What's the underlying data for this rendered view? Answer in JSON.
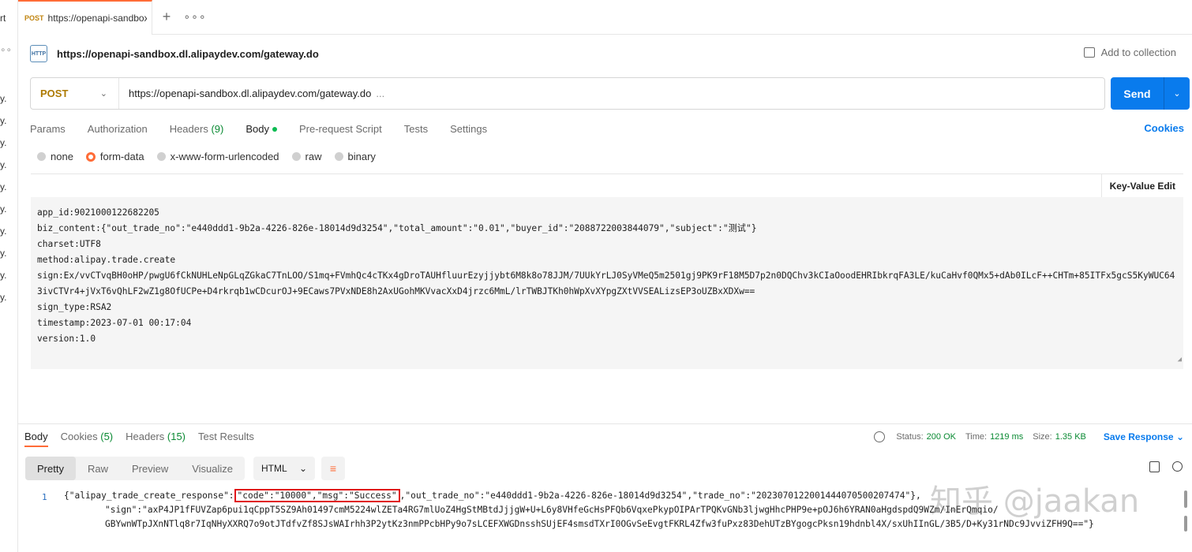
{
  "left_strip": {
    "fragments": [
      "rt",
      "∘∘",
      "y.",
      "y.",
      "y.",
      "y.",
      "y.",
      "y.",
      "y.",
      "y.",
      "y."
    ]
  },
  "tab": {
    "method": "POST",
    "url": "https://openapi-sandbox.dl.alipaydev.com/gateway.do"
  },
  "request": {
    "title": "https://openapi-sandbox.dl.alipaydev.com/gateway.do",
    "add_to_collection": "Add to collection",
    "method": "POST",
    "url": "https://openapi-sandbox.dl.alipaydev.com/gateway.do",
    "url_more": "...",
    "send": "Send"
  },
  "request_tabs": {
    "params": "Params",
    "authorization": "Authorization",
    "headers": "Headers",
    "headers_count": "(9)",
    "body": "Body",
    "pre_request": "Pre-request Script",
    "tests": "Tests",
    "settings": "Settings",
    "cookies": "Cookies"
  },
  "body_types": {
    "none": "none",
    "form_data": "form-data",
    "urlencoded": "x-www-form-urlencoded",
    "raw": "raw",
    "binary": "binary",
    "selected": "form-data"
  },
  "key_value_edit": "Key-Value Edit",
  "body_lines": [
    "app_id:9021000122682205",
    "biz_content:{\"out_trade_no\":\"e440ddd1-9b2a-4226-826e-18014d9d3254\",\"total_amount\":\"0.01\",\"buyer_id\":\"2088722003844079\",\"subject\":\"测试\"}",
    "charset:UTF8",
    "method:alipay.trade.create",
    "sign:Ex/vvCTvqBH0oHP/pwgU6fCkNUHLeNpGLqZGkaC7TnLOO/S1mq+FVmhQc4cTKx4gDroTAUHfluurEzyjjybt6M8k8o78JJM/7UUkYrLJ0SyVMeQ5m2501gj9PK9rF18M5D7p2n0DQChv3kCIaOoodEHRIbkrqFA3LE/kuCaHvf0QMx5+dAb0ILcF++CHTm+85ITFx5gcS5KyWUC643ivCTVr4+jVxT6vQhLF2wZ1g8OfUCPe+D4rkrqb1wCDcurOJ+9ECaws7PVxNDE8h2AxUGohMKVvacXxD4jrzc6MmL/lrTWBJTKh0hWpXvXYpgZXtVVSEALizsEP3oUZBxXDXw==",
    "sign_type:RSA2",
    "timestamp:2023-07-01 00:17:04",
    "version:1.0"
  ],
  "response": {
    "tabs": {
      "body": "Body",
      "cookies": "Cookies",
      "cookies_count": "(5)",
      "headers": "Headers",
      "headers_count": "(15)",
      "test_results": "Test Results"
    },
    "status_label": "Status:",
    "status": "200 OK",
    "time_label": "Time:",
    "time": "1219 ms",
    "size_label": "Size:",
    "size": "1.35 KB",
    "save": "Save Response",
    "views": {
      "pretty": "Pretty",
      "raw": "Raw",
      "preview": "Preview",
      "visualize": "Visualize"
    },
    "format": "HTML",
    "line_number": "1",
    "line1_pre": "{\"alipay_trade_create_response\":",
    "line1_boxed": "\"code\":\"10000\",\"msg\":\"Success\"",
    "line1_post": ",\"out_trade_no\":\"e440ddd1-9b2a-4226-826e-18014d9d3254\",\"trade_no\":\"2023070122001444070500207474\"},",
    "line2": "\"sign\":\"axP4JP1fFUVZap6pui1qCppT5SZ9Ah01497cmM5224wlZETa4RG7mlUoZ4HgStMBtdJjjgW+U+L6y8VHfeGcHsPFQb6VqxePkypOIPArTPQKvGNb3ljwgHhcPHP9e+pOJ6h6YRAN0aHgdspdQ9WZm/InErQmqio/",
    "line3": "GBYwnWTpJXnNTlq8r7IqNHyXXRQ7o9otJTdfvZf8SJsWAIrhh3P2ytKz3nmPPcbHPy9o7sLCEFXWGDnsshSUjEF4smsdTXrI0OGvSeEvgtFKRL4Zfw3fuPxz83DehUTzBYgogcPksn19hdnbl4X/sxUhIInGL/3B5/D+Ky31rNDc9JvviZFH9Q==\"}"
  },
  "watermark": "知乎 @jaakan",
  "colors": {
    "accent": "#ff6c37",
    "send": "#097bed",
    "success": "#0a8a33",
    "highlight_box": "#e0161a"
  }
}
